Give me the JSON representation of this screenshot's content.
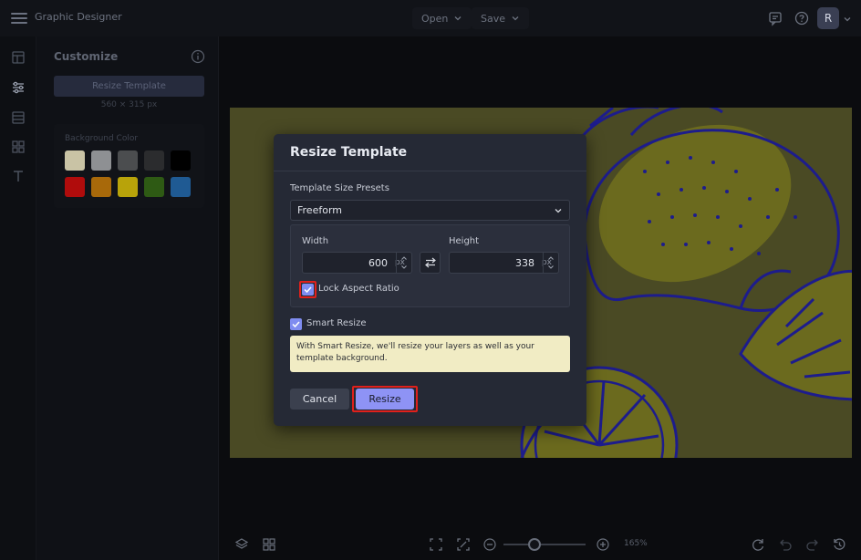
{
  "header": {
    "app_title": "Graphic Designer",
    "open_label": "Open",
    "save_label": "Save",
    "user_initial": "R",
    "icons": [
      "hamburger-menu-icon",
      "comment-icon",
      "help-icon",
      "chevron-down-icon"
    ]
  },
  "rail": {
    "icons": [
      "layout-icon",
      "sliders-icon",
      "template-icon",
      "elements-grid-icon",
      "text-icon"
    ]
  },
  "panel": {
    "title": "Customize",
    "resize_button_label": "Resize Template",
    "current_size": "560 × 315 px",
    "background_color_label": "Background Color",
    "swatches": [
      "#c9c3a5",
      "#8e9093",
      "#4b4d4f",
      "#2b2c2e",
      "#000000",
      "#b00c0c",
      "#a8690a",
      "#b8a30a",
      "#2e5a14",
      "#1f5a93"
    ]
  },
  "modal": {
    "title": "Resize Template",
    "presets_label": "Template Size Presets",
    "preset_value": "Freeform",
    "width_label": "Width",
    "width_value": "600",
    "height_label": "Height",
    "height_value": "338",
    "unit": "px",
    "lock_aspect_label": "Lock Aspect Ratio",
    "lock_aspect_checked": true,
    "smart_resize_label": "Smart Resize",
    "smart_resize_checked": true,
    "smart_resize_note": "With Smart Resize, we'll resize your layers as well as your template background.",
    "cancel_label": "Cancel",
    "resize_label": "Resize"
  },
  "footer": {
    "zoom_label": "165%"
  },
  "colors": {
    "accent": "#8e93f5",
    "highlight": "#e0201b",
    "canvas_background": "#4a4a24",
    "lemon_fill": "#6b6a1e",
    "lemon_stroke": "#1d1c8c"
  }
}
